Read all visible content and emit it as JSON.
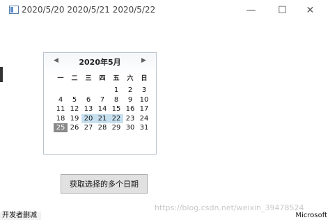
{
  "window": {
    "title": "2020/5/20 2020/5/21 2020/5/22",
    "minimize_glyph": "—",
    "maximize_glyph": "☐",
    "close_glyph": "✕",
    "icon": "window-app-icon"
  },
  "calendar": {
    "month_title": "2020年5月",
    "prev_glyph": "◀",
    "next_glyph": "▶",
    "weekdays": [
      "一",
      "二",
      "三",
      "四",
      "五",
      "六",
      "日"
    ],
    "weeks": [
      [
        "",
        "",
        "",
        "",
        "1",
        "2",
        "3"
      ],
      [
        "4",
        "5",
        "6",
        "7",
        "8",
        "9",
        "10"
      ],
      [
        "11",
        "12",
        "13",
        "14",
        "15",
        "16",
        "17"
      ],
      [
        "18",
        "19",
        "20",
        "21",
        "22",
        "23",
        "24"
      ],
      [
        "25",
        "26",
        "27",
        "28",
        "29",
        "30",
        "31"
      ]
    ],
    "selected_days": [
      "20",
      "21",
      "22"
    ],
    "today": "25",
    "colors": {
      "selected": "#c7e0ef",
      "today": "#8a8a8a"
    }
  },
  "action_button_label": "获取选择的多个日期",
  "taskbar": {
    "left_text": "开发者删减",
    "right_text": "Microsoft"
  },
  "watermark": "https://blog.csdn.net/weixin_39478524"
}
